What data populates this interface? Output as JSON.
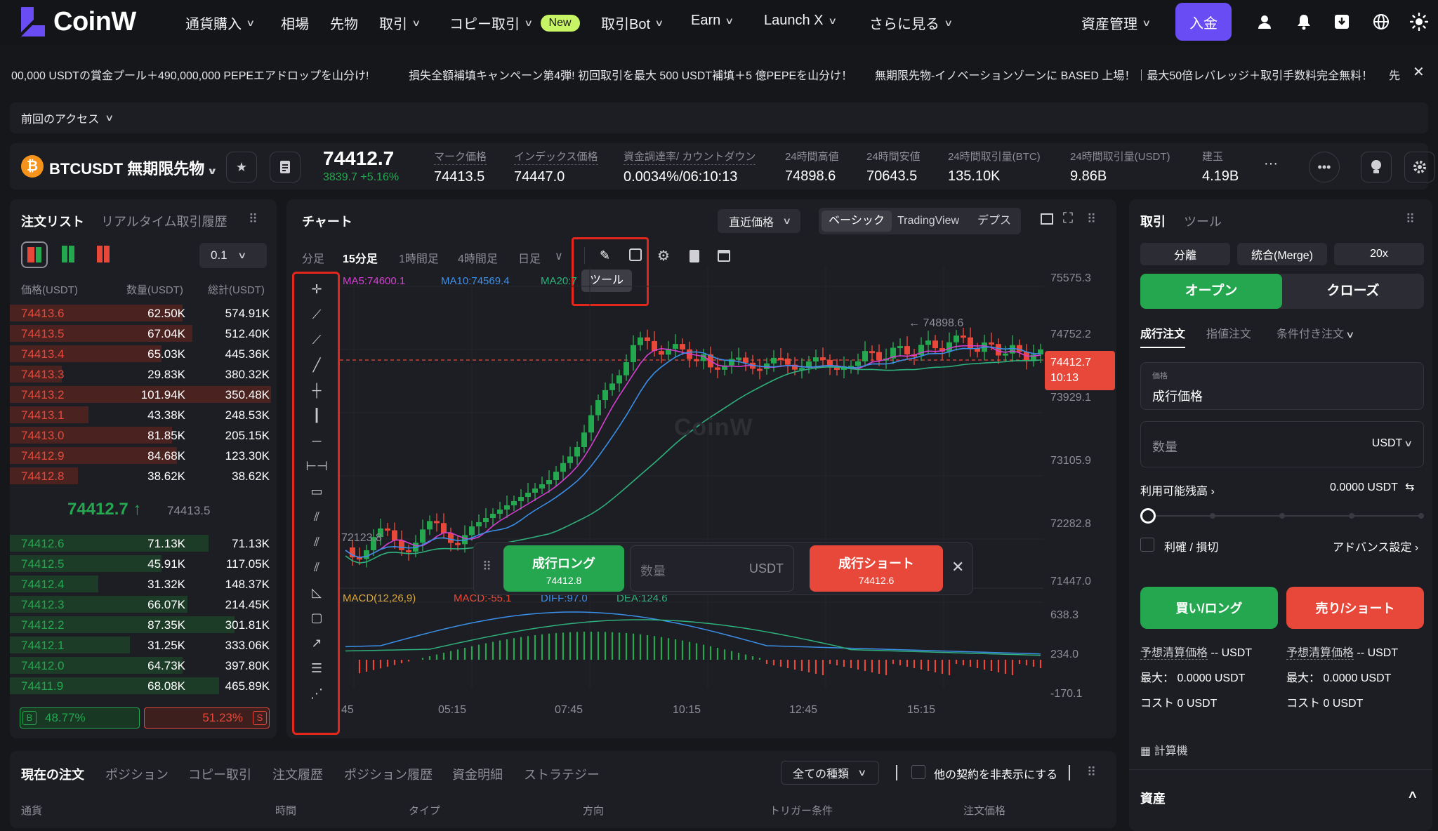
{
  "nav": {
    "logo": "CoinW",
    "items": [
      {
        "label": "通貨購入",
        "chevron": true
      },
      {
        "label": "相場",
        "chevron": false
      },
      {
        "label": "先物",
        "chevron": false
      },
      {
        "label": "取引",
        "chevron": true
      },
      {
        "label": "コピー取引",
        "chevron": true
      },
      {
        "label": "取引Bot",
        "chevron": true
      },
      {
        "label": "Earn",
        "chevron": true
      },
      {
        "label": "Launch X",
        "chevron": true
      },
      {
        "label": "さらに見る",
        "chevron": true
      }
    ],
    "new_badge": "New",
    "asset_mgmt": "資産管理",
    "deposit": "入金",
    "icons": [
      "user-icon",
      "bell-icon",
      "download-icon",
      "globe-icon",
      "sun-icon"
    ]
  },
  "ticker": {
    "items": [
      "00,000 USDTの賞金プール＋490,000,000 PEPEエアドロップを山分け!",
      "損失全額補填キャンペーン第4弾! 初回取引を最大 500 USDT補填＋5 億PEPEを山分け！",
      "無期限先物-イノベーションゾーンに BASED 上場！｜最大50倍レバレッジ＋取引手数料完全無料！",
      "先"
    ]
  },
  "recent": {
    "label": "前回のアクセス"
  },
  "symbol": {
    "coin_letter": "₿",
    "name": "BTCUSDT 無期限先物",
    "last_price": "74412.7",
    "change": "3839.7 +5.16%",
    "stats": [
      {
        "label": "マーク価格",
        "value": "74413.5",
        "dashed": true
      },
      {
        "label": "インデックス価格",
        "value": "74447.0",
        "dashed": true
      },
      {
        "label": "資金調達率/ カウントダウン",
        "value": "0.0034%/06:10:13",
        "dashed": true
      },
      {
        "label": "24時間高値",
        "value": "74898.6",
        "dashed": false
      },
      {
        "label": "24時間安値",
        "value": "70643.5",
        "dashed": false
      },
      {
        "label": "24時間取引量(BTC)",
        "value": "135.10K",
        "dashed": false
      },
      {
        "label": "24時間取引量(USDT)",
        "value": "9.86B",
        "dashed": false
      },
      {
        "label": "建玉",
        "value": "4.19B",
        "dashed": false
      }
    ],
    "more": "···"
  },
  "orderbook": {
    "title": "注文リスト",
    "tab2": "リアルタイム取引履歴",
    "precision": "0.1",
    "headers": [
      "価格(USDT)",
      "数量(USDT)",
      "総計(USDT)"
    ],
    "asks": [
      {
        "price": "74413.6",
        "qty": "62.50K",
        "total": "574.91K",
        "depth": 0.66
      },
      {
        "price": "74413.5",
        "qty": "67.04K",
        "total": "512.40K",
        "depth": 0.7
      },
      {
        "price": "74413.4",
        "qty": "65.03K",
        "total": "445.36K",
        "depth": 0.58
      },
      {
        "price": "74413.3",
        "qty": "29.83K",
        "total": "380.32K",
        "depth": 0.2
      },
      {
        "price": "74413.2",
        "qty": "101.94K",
        "total": "350.48K",
        "depth": 1.0
      },
      {
        "price": "74413.1",
        "qty": "43.38K",
        "total": "248.53K",
        "depth": 0.3
      },
      {
        "price": "74413.0",
        "qty": "81.85K",
        "total": "205.15K",
        "depth": 0.62
      },
      {
        "price": "74412.9",
        "qty": "84.68K",
        "total": "123.30K",
        "depth": 0.64
      },
      {
        "price": "74412.8",
        "qty": "38.62K",
        "total": "38.62K",
        "depth": 0.26
      }
    ],
    "mid_price": "74412.7 ↑",
    "mid_mark": "74413.5",
    "bids": [
      {
        "price": "74412.6",
        "qty": "71.13K",
        "total": "71.13K",
        "depth": 0.76
      },
      {
        "price": "74412.5",
        "qty": "45.91K",
        "total": "117.05K",
        "depth": 0.58
      },
      {
        "price": "74412.4",
        "qty": "31.32K",
        "total": "148.37K",
        "depth": 0.34
      },
      {
        "price": "74412.3",
        "qty": "66.07K",
        "total": "214.45K",
        "depth": 0.68
      },
      {
        "price": "74412.2",
        "qty": "87.35K",
        "total": "301.81K",
        "depth": 0.86
      },
      {
        "price": "74412.1",
        "qty": "31.25K",
        "total": "333.06K",
        "depth": 0.46
      },
      {
        "price": "74412.0",
        "qty": "64.73K",
        "total": "397.80K",
        "depth": 0.66
      },
      {
        "price": "74411.9",
        "qty": "68.08K",
        "total": "465.89K",
        "depth": 0.8
      }
    ],
    "buy_ratio": "48.77%",
    "sell_ratio": "51.23%",
    "buy_letter": "B",
    "sell_letter": "S",
    "buy_fraction": 0.4877
  },
  "chart": {
    "title": "チャート",
    "price_select": "直近価格",
    "views": [
      "ベーシック",
      "TradingView",
      "デプス"
    ],
    "timeframes": [
      "分足",
      "15分足",
      "1時間足",
      "4時間足",
      "日足"
    ],
    "tooltip": "ツール",
    "watermark": "CoinW",
    "ma_labels": [
      {
        "text": "MA5:74600.1",
        "color": "#d43fd0"
      },
      {
        "text": "MA10:74569.4",
        "color": "#3b8fe8"
      },
      {
        "text": "MA20:7",
        "color": "#2eb07c"
      }
    ],
    "price_axis": [
      "75575.3",
      "74752.2",
      "73929.1",
      "73105.9",
      "72282.8",
      "71447.0",
      "638.3",
      "234.0",
      "-170.1"
    ],
    "high_marker": "← 74898.6",
    "low_marker": "72123.8",
    "current_price": "74412.7",
    "countdown": "10:13",
    "macd": {
      "label": "MACD(12,26,9)",
      "macd": "MACD:-55.1",
      "diff": "DIFF:97.0",
      "dea": "DEA:124.6"
    },
    "time_axis": [
      "45",
      "05:15",
      "07:45",
      "10:15",
      "12:45",
      "15:15"
    ]
  },
  "quick_order": {
    "long_label": "成行ロング",
    "long_price": "74412.8",
    "qty_placeholder": "数量",
    "unit": "USDT",
    "short_label": "成行ショート",
    "short_price": "74412.6"
  },
  "trade": {
    "title": "取引",
    "tab2": "ツール",
    "modes": [
      "分離",
      "統合(Merge)",
      "20x"
    ],
    "open": "オープン",
    "close": "クローズ",
    "order_types": [
      "成行注文",
      "指値注文",
      "条件付き注文"
    ],
    "price_caption": "価格",
    "price_value": "成行価格",
    "qty_label": "数量",
    "qty_unit": "USDT",
    "available_label": "利用可能残高",
    "available_value": "0.0000 USDT",
    "tp_sl": "利確 / 損切",
    "advanced": "アドバンス設定",
    "buy_btn": "買い/ロング",
    "sell_btn": "売り/ショート",
    "liq_label": "予想清算価格",
    "liq_value": "-- USDT",
    "max_label": "最大：",
    "max_value": "0.0000 USDT",
    "cost_label": "コスト",
    "cost_value": "0 USDT",
    "calculator": "計算機",
    "assets": "資産"
  },
  "bottom": {
    "tabs": [
      "現在の注文",
      "ポジション",
      "コピー取引",
      "注文履歴",
      "ポジション履歴",
      "資金明細",
      "ストラテジー"
    ],
    "filter": "全ての種類",
    "hide_other": "他の契約を非表示にする",
    "columns": [
      "通貨",
      "時間",
      "タイプ",
      "方向",
      "トリガー条件",
      "注文価格"
    ]
  }
}
